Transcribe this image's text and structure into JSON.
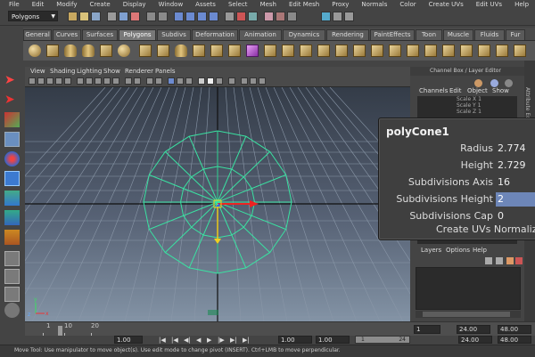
{
  "menubar": {
    "items": [
      "File",
      "Edit",
      "Modify",
      "Create",
      "Display",
      "Window",
      "Assets",
      "Select",
      "Mesh",
      "Edit Mesh",
      "Proxy",
      "Normals",
      "Color",
      "Create UVs",
      "Edit UVs",
      "Help"
    ]
  },
  "statusline": {
    "mode": "Polygons"
  },
  "shelf": {
    "tabs": [
      "General",
      "Curves",
      "Surfaces",
      "Polygons",
      "Subdivs",
      "Deformation",
      "Animation",
      "Dynamics",
      "Rendering",
      "PaintEffects",
      "Toon",
      "Muscle",
      "Fluids",
      "Fur"
    ],
    "active_tab": "Polygons",
    "icons": [
      "poly-sphere-icon",
      "poly-cube-icon",
      "poly-cylinder-icon",
      "poly-cone-icon",
      "poly-plane-icon",
      "poly-torus-icon",
      "poly-prism-icon",
      "poly-pyramid-icon",
      "poly-pipe-icon",
      "poly-helix-icon",
      "poly-soccer-icon",
      "poly-platonic-icon"
    ]
  },
  "viewport": {
    "menu": [
      "View",
      "Shading",
      "Lighting",
      "Show",
      "Renderer",
      "Panels"
    ],
    "grid_color": "#8a97a8",
    "wire_color": "#3ae2a2",
    "axis_x_color": "#e22",
    "axis_y_color": "#f0d020",
    "axis_z_color": "#3060ff",
    "cone": {
      "sides": 16,
      "rings": 2
    }
  },
  "channelbox": {
    "title": "Channel Box / Layer Editor",
    "menu": [
      "Channels",
      "Edit",
      "Object",
      "Show"
    ],
    "list": [
      "Scale X 1",
      "Scale Y 1",
      "Scale Z 1"
    ],
    "layers_menu": [
      "Layers",
      "Options",
      "Help"
    ],
    "attribute_editor_label": "Attribute Editor"
  },
  "popup": {
    "title": "polyCone1",
    "rows": [
      {
        "label": "Radius",
        "value": "2.774",
        "selected": false
      },
      {
        "label": "Height",
        "value": "2.729",
        "selected": false
      },
      {
        "label": "Subdivisions Axis",
        "value": "16",
        "selected": false
      },
      {
        "label": "Subdivisions Height",
        "value": "2",
        "selected": true
      },
      {
        "label": "Subdivisions Cap",
        "value": "0",
        "selected": false
      }
    ],
    "uvs_label": "Create UVs",
    "uvs_value": "Normaliz"
  },
  "timeline": {
    "ticks": [
      "1",
      "10",
      "20"
    ],
    "range_start": "1.00",
    "current_time": "1.00",
    "current_frame": "1",
    "playback_start": "1.00",
    "playback_end": "24.00",
    "range_slider_start": "1",
    "range_slider_end": "24",
    "anim_end": "48.00",
    "anim_end_outer": "24.00"
  },
  "helpline": {
    "text": "Move Tool: Use manipulator to move object(s). Use edit mode to change pivot (INSERT).  Ctrl+LMB to move perpendicular."
  }
}
